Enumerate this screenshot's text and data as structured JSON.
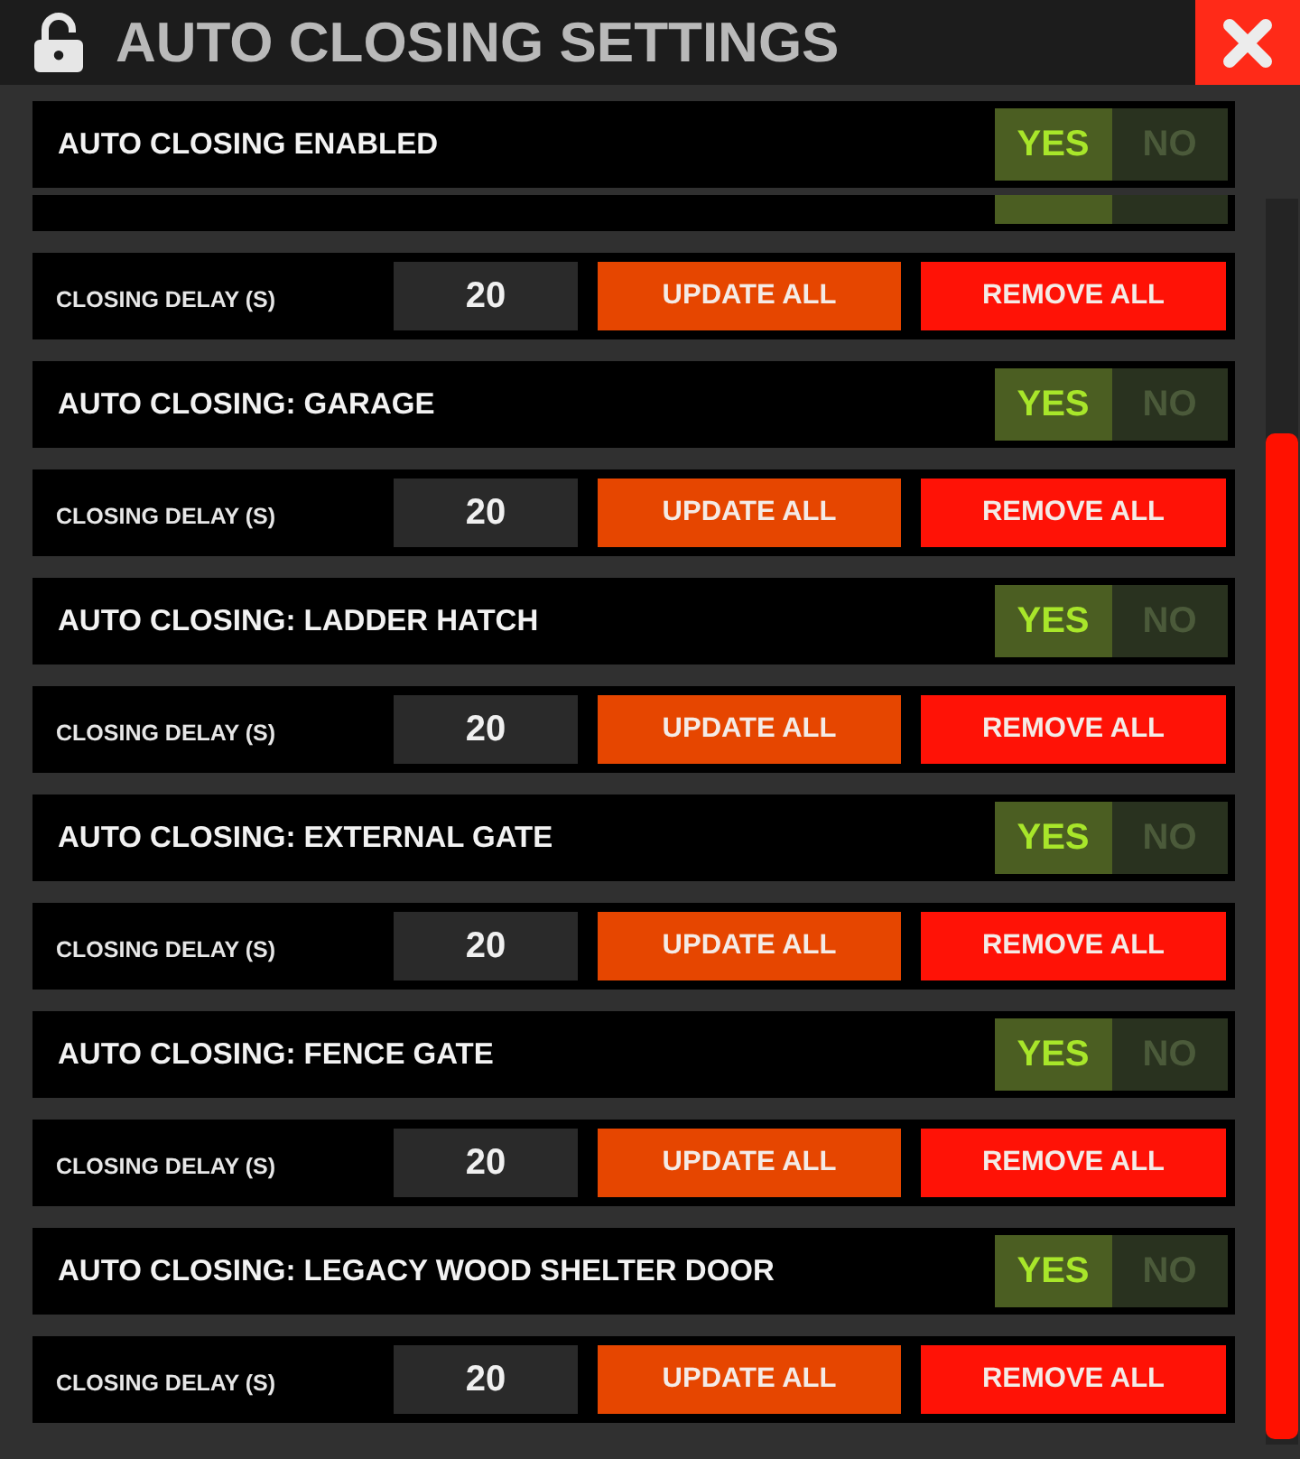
{
  "window": {
    "title": "AUTO CLOSING SETTINGS"
  },
  "master_setting": {
    "label": "AUTO CLOSING ENABLED",
    "options": [
      {
        "label": "YES",
        "selected": true
      },
      {
        "label": "NO",
        "selected": false
      }
    ]
  },
  "settings": [
    {
      "options": [
        {
          "selected": true
        },
        {
          "selected": false
        }
      ],
      "delay": {
        "label": "CLOSING DELAY (S)",
        "value": "20",
        "buttons": [
          {
            "label": "UPDATE ALL",
            "kind": "update"
          },
          {
            "label": "REMOVE ALL",
            "kind": "remove"
          }
        ]
      }
    },
    {
      "label": "AUTO CLOSING: GARAGE",
      "options": [
        {
          "label": "YES",
          "selected": true
        },
        {
          "label": "NO",
          "selected": false
        }
      ],
      "delay": {
        "label": "CLOSING DELAY (S)",
        "value": "20",
        "buttons": [
          {
            "label": "UPDATE ALL",
            "kind": "update"
          },
          {
            "label": "REMOVE ALL",
            "kind": "remove"
          }
        ]
      }
    },
    {
      "label": "AUTO CLOSING: LADDER HATCH",
      "options": [
        {
          "label": "YES",
          "selected": true
        },
        {
          "label": "NO",
          "selected": false
        }
      ],
      "delay": {
        "label": "CLOSING DELAY (S)",
        "value": "20",
        "buttons": [
          {
            "label": "UPDATE ALL",
            "kind": "update"
          },
          {
            "label": "REMOVE ALL",
            "kind": "remove"
          }
        ]
      }
    },
    {
      "label": "AUTO CLOSING: EXTERNAL GATE",
      "options": [
        {
          "label": "YES",
          "selected": true
        },
        {
          "label": "NO",
          "selected": false
        }
      ],
      "delay": {
        "label": "CLOSING DELAY (S)",
        "value": "20",
        "buttons": [
          {
            "label": "UPDATE ALL",
            "kind": "update"
          },
          {
            "label": "REMOVE ALL",
            "kind": "remove"
          }
        ]
      }
    },
    {
      "label": "AUTO CLOSING: FENCE GATE",
      "options": [
        {
          "label": "YES",
          "selected": true
        },
        {
          "label": "NO",
          "selected": false
        }
      ],
      "delay": {
        "label": "CLOSING DELAY (S)",
        "value": "20",
        "buttons": [
          {
            "label": "UPDATE ALL",
            "kind": "update"
          },
          {
            "label": "REMOVE ALL",
            "kind": "remove"
          }
        ]
      }
    },
    {
      "label": "AUTO CLOSING: LEGACY WOOD SHELTER DOOR",
      "options": [
        {
          "label": "YES",
          "selected": true
        },
        {
          "label": "NO",
          "selected": false
        }
      ],
      "delay": {
        "label": "CLOSING DELAY (S)",
        "value": "20",
        "buttons": [
          {
            "label": "UPDATE ALL",
            "kind": "update"
          },
          {
            "label": "REMOVE ALL",
            "kind": "remove"
          }
        ]
      }
    }
  ]
}
